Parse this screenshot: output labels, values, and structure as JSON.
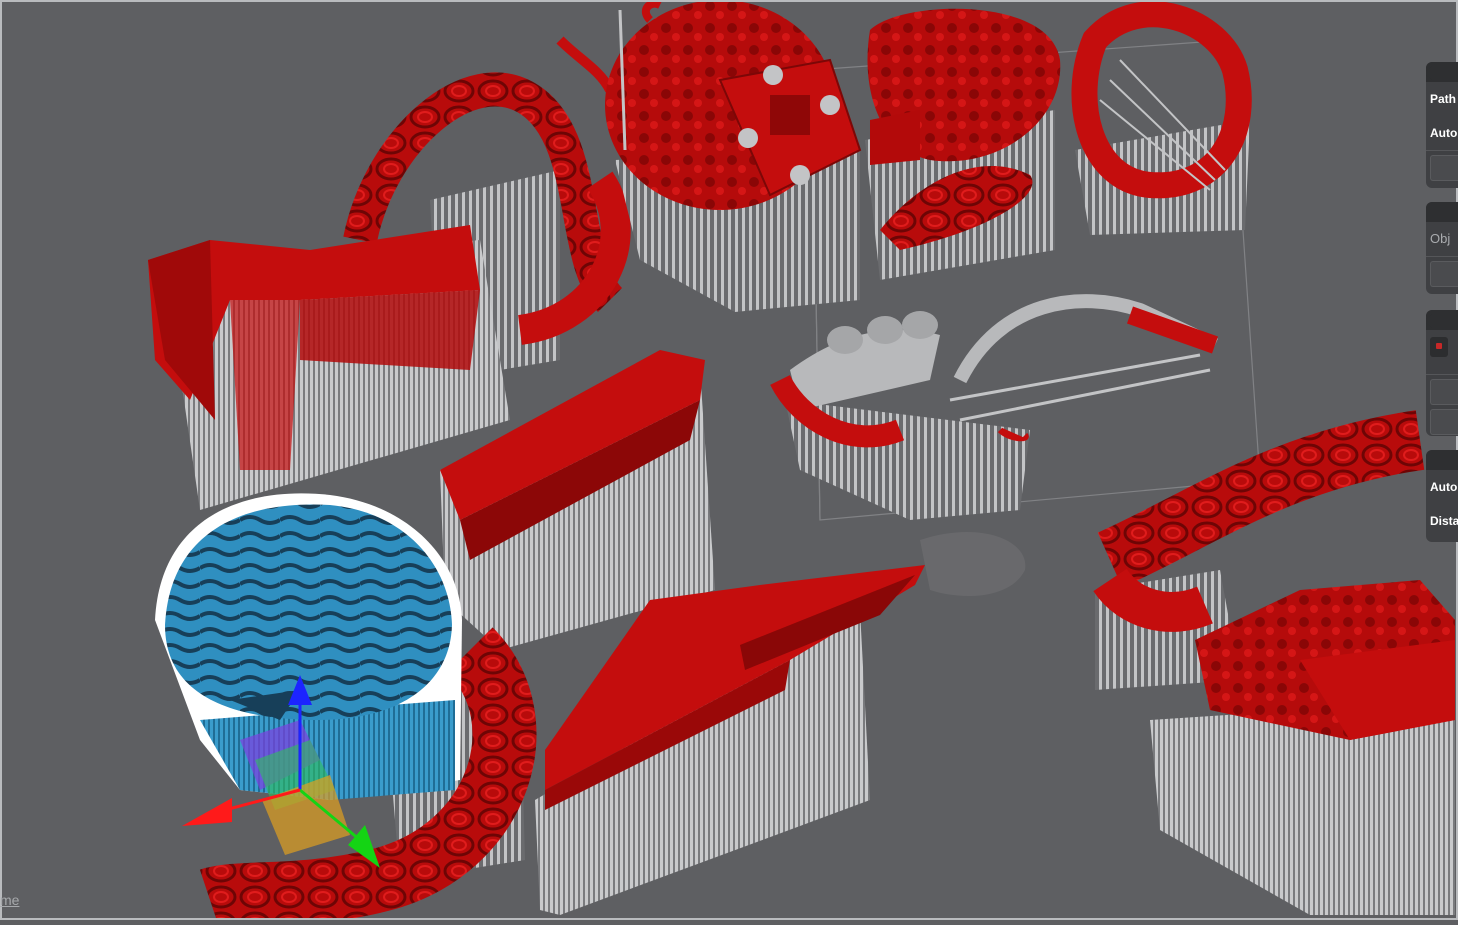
{
  "app": {
    "viewport_label": "3D build plate viewport",
    "corner_link": "me"
  },
  "colors": {
    "background": "#5e5f62",
    "model_red": "#c40d0d",
    "model_red_dark": "#7c0707",
    "support_gray": "#b7b8ba",
    "selected_blue": "#2b86b4",
    "selected_blue_dark": "#1d4b66",
    "axis_x": "#ff1a1a",
    "axis_y": "#14d414",
    "axis_z": "#1c24ff",
    "panel_bg": "#3f4043"
  },
  "icons": {
    "move_gizmo": "translate-gizmo-icon"
  },
  "panels": {
    "supports": {
      "rows": [
        "Path",
        "Auto"
      ]
    },
    "objects": {
      "rows": [
        "Obj"
      ]
    },
    "layers": {
      "rows": []
    },
    "generation": {
      "rows": [
        "Auto",
        "Dista"
      ]
    }
  }
}
